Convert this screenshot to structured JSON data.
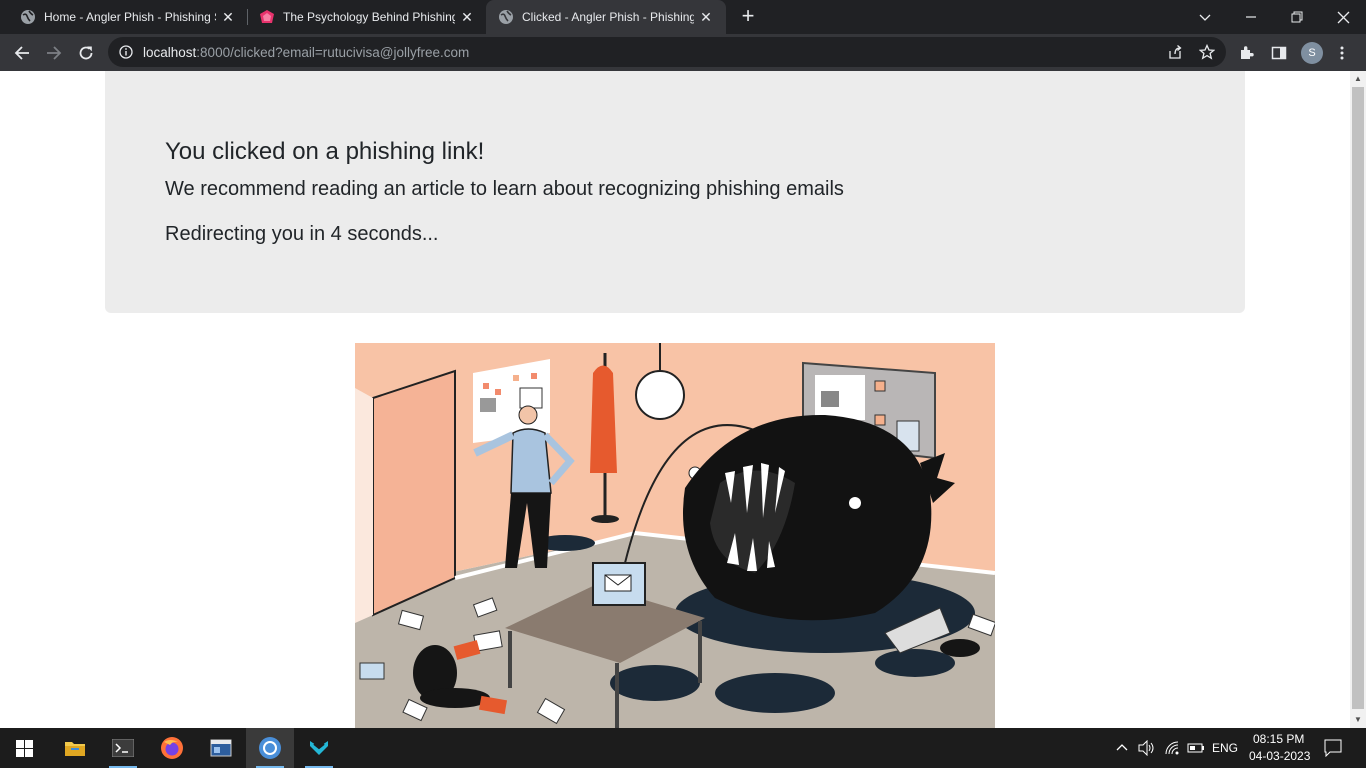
{
  "browser": {
    "tabs": [
      {
        "title": "Home - Angler Phish - Phishing S"
      },
      {
        "title": "The Psychology Behind Phishing"
      },
      {
        "title": "Clicked - Angler Phish - Phishing"
      }
    ],
    "url_host": "localhost",
    "url_rest": ":8000/clicked?email=rutucivisa@jollyfree.com",
    "profile_initial": "S"
  },
  "page": {
    "heading": "You clicked on a phishing link!",
    "lead": "We recommend reading an article to learn about recognizing phishing emails",
    "redirect": "Redirecting you in 4 seconds..."
  },
  "taskbar": {
    "language": "ENG",
    "time": "08:15 PM",
    "date": "04-03-2023"
  },
  "colors": {
    "tab_strip": "#202124",
    "toolbar": "#35363a",
    "jumbotron": "#ececec",
    "illustration_wall": "#f7bfa3"
  }
}
